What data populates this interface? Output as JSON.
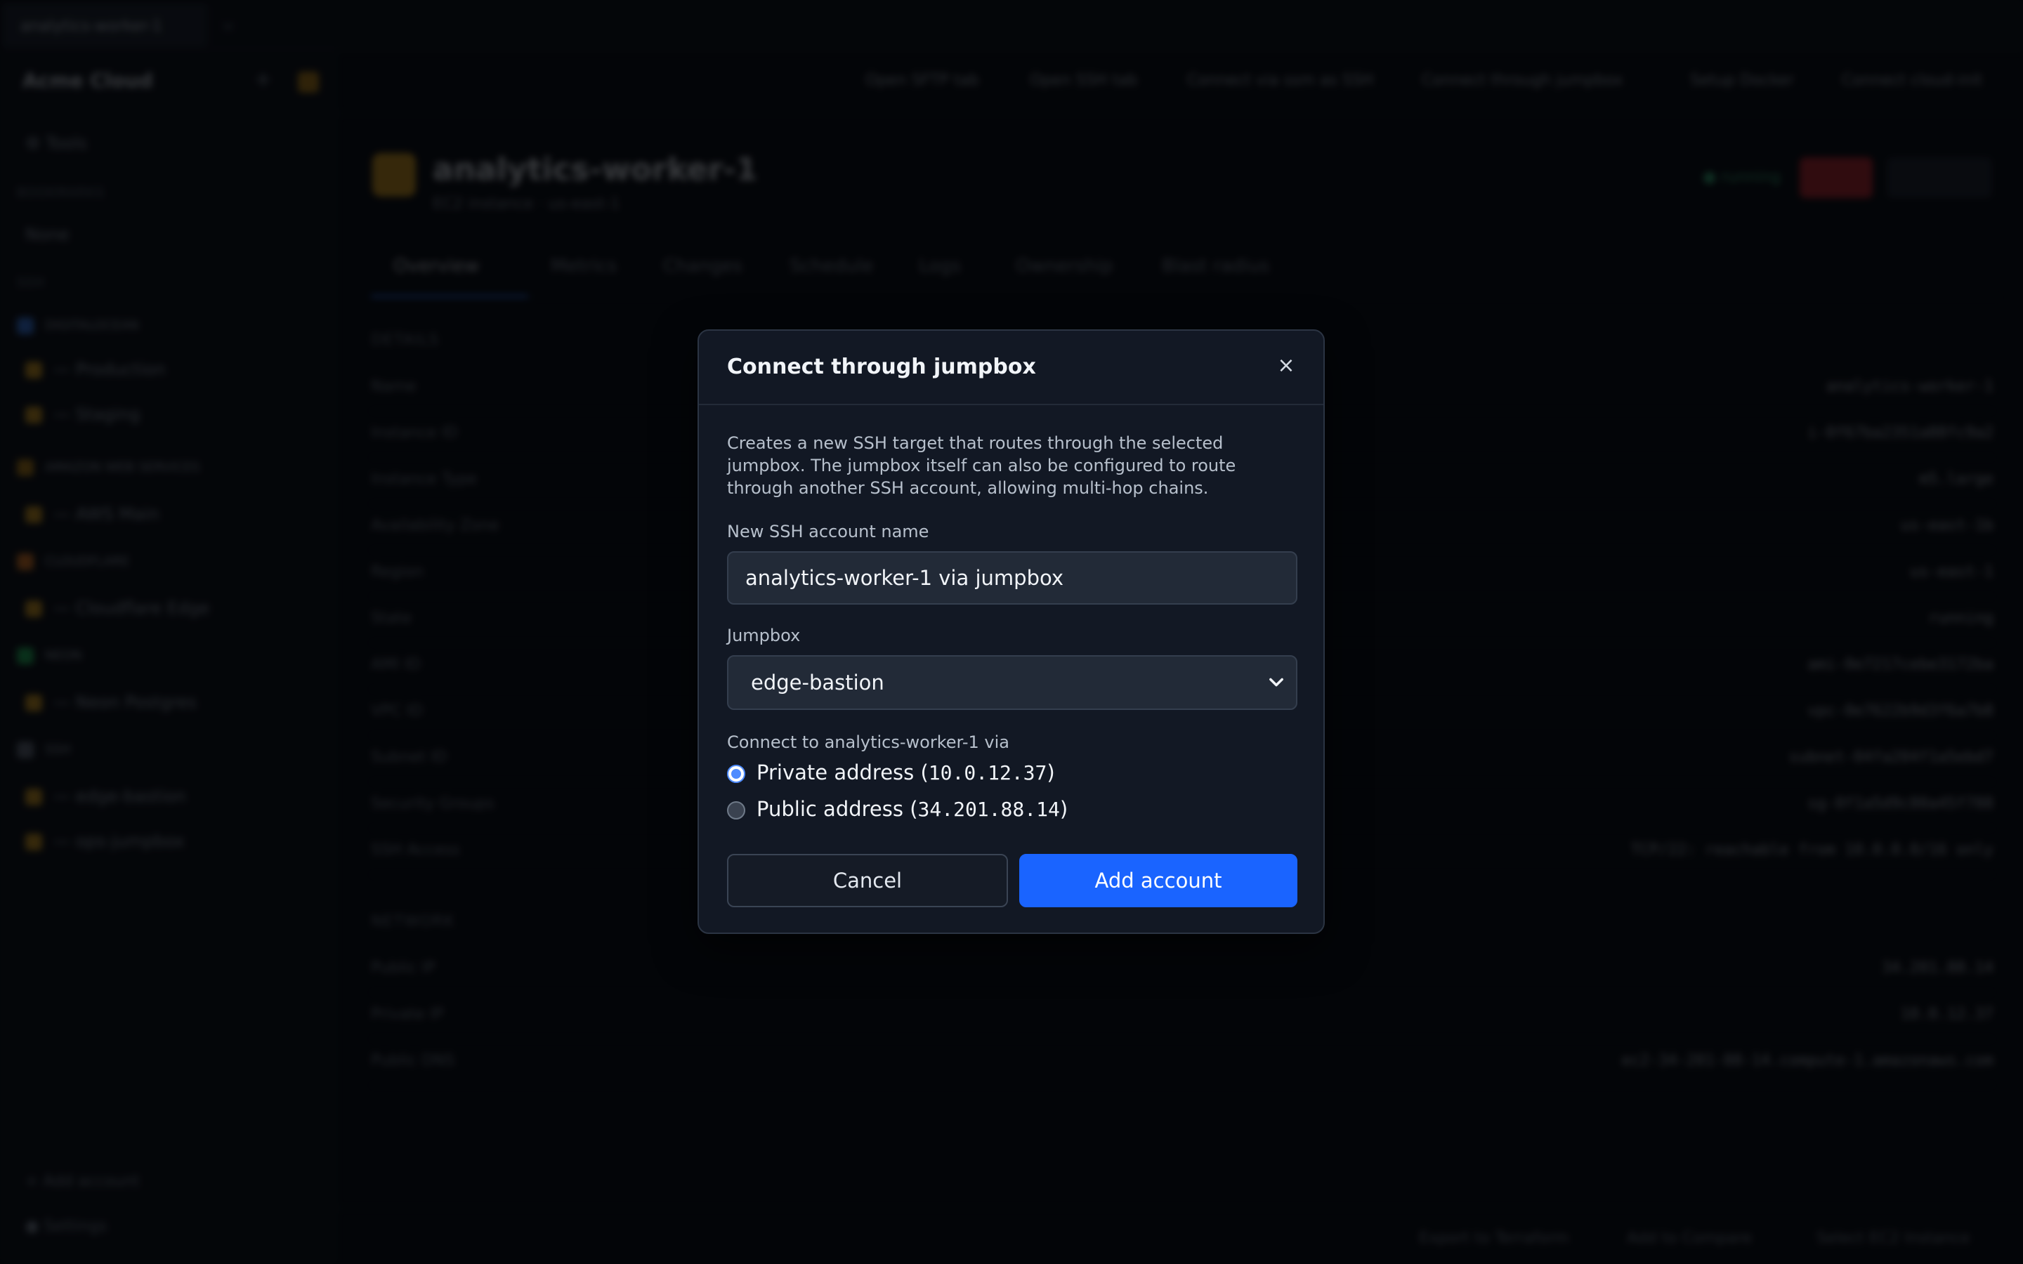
{
  "background": {
    "tab": "analytics-worker-1",
    "sidebar": {
      "brand": "Acme Cloud",
      "tools": "Tools",
      "bookmarks_label": "BOOKMARKS",
      "none": "None",
      "ssh_label": "SSH",
      "groups": [
        {
          "label": "DIGITALOCEAN",
          "color": "#3b82f6"
        },
        {
          "label": "— Production",
          "color": "#e3a41b"
        },
        {
          "label": "— Staging",
          "color": "#e3a41b"
        },
        {
          "label": "AMAZON WEB SERVICES",
          "color": "#c68a12"
        },
        {
          "label": "— AWS Main",
          "color": "#e3a41b"
        },
        {
          "label": "CLOUDFLARE",
          "color": "#f38020"
        },
        {
          "label": "— Cloudflare Edge",
          "color": "#e3a41b"
        },
        {
          "label": "NEON",
          "color": "#22c55e"
        },
        {
          "label": "— Neon Postgres",
          "color": "#e3a41b"
        },
        {
          "label": "SSH",
          "color": "#6b7280"
        },
        {
          "label": "— edge-bastion",
          "color": "#e3a41b"
        },
        {
          "label": "— ops-jumpbox",
          "color": "#e3a41b"
        }
      ],
      "add_account": "Add account",
      "settings": "Settings"
    },
    "topbar_actions": [
      "Open SFTP tab",
      "Open SSH tab",
      "Connect via ssm as SSH",
      "Connect through jumpbox",
      "Setup Docker",
      "Connect cloud-init"
    ],
    "header": {
      "title": "analytics-worker-1",
      "subtitle": "EC2 instance · us-east-1",
      "status": "running",
      "stop": "Stop",
      "refresh": "Refresh"
    },
    "tabs": [
      "Overview",
      "Metrics",
      "Changes",
      "Schedule",
      "Logs",
      "Ownership",
      "Blast radius"
    ],
    "details_label": "DETAILS",
    "details": [
      {
        "k": "Name",
        "v": "analytics-worker-1"
      },
      {
        "k": "Instance ID",
        "v": "i-0f67ba2351a88fc9a2"
      },
      {
        "k": "Instance Type",
        "v": "m5.large"
      },
      {
        "k": "Availability Zone",
        "v": "us-east-1b"
      },
      {
        "k": "Region",
        "v": "us-east-1"
      },
      {
        "k": "State",
        "v": "running"
      },
      {
        "k": "AMI ID",
        "v": "ami-0e7217cebe3172ba"
      },
      {
        "k": "VPC ID",
        "v": "vpc-0e7622b9d3f6a7b8"
      },
      {
        "k": "Subnet ID",
        "v": "subnet-04fa204f1a5ebd7"
      },
      {
        "k": "Security Groups",
        "v": "sg-0f1a5d9c80a45f788"
      },
      {
        "k": "SSH Access",
        "v": "TCP/22: reachable from 10.0.0.0/16 only"
      }
    ],
    "network_label": "NETWORK",
    "network": [
      {
        "k": "Public IP",
        "v": "34.201.88.14"
      },
      {
        "k": "Private IP",
        "v": "10.0.12.37"
      },
      {
        "k": "Public DNS",
        "v": "ec2-34-201-88-14.compute-1.amazonaws.com"
      }
    ],
    "footer": [
      "Export to Terraform",
      "Add to Compare",
      "Select EC2 Instance"
    ]
  },
  "modal": {
    "title": "Connect through jumpbox",
    "close": "×",
    "description": "Creates a new SSH target that routes through the selected jumpbox. The jumpbox itself can also be configured to route through another SSH account, allowing multi-hop chains.",
    "account_name_label": "New SSH account name",
    "account_name_value": "analytics-worker-1 via jumpbox",
    "jumpbox_label": "Jumpbox",
    "jumpbox_selected": "edge-bastion",
    "connect_label": "Connect to analytics-worker-1 via",
    "options": [
      {
        "prefix": "Private address (",
        "ip": "10.0.12.37",
        "suffix": ")",
        "checked": true
      },
      {
        "prefix": "Public address (",
        "ip": "34.201.88.14",
        "suffix": ")",
        "checked": false
      }
    ],
    "cancel": "Cancel",
    "submit": "Add account",
    "accent": "#1a64ff"
  }
}
